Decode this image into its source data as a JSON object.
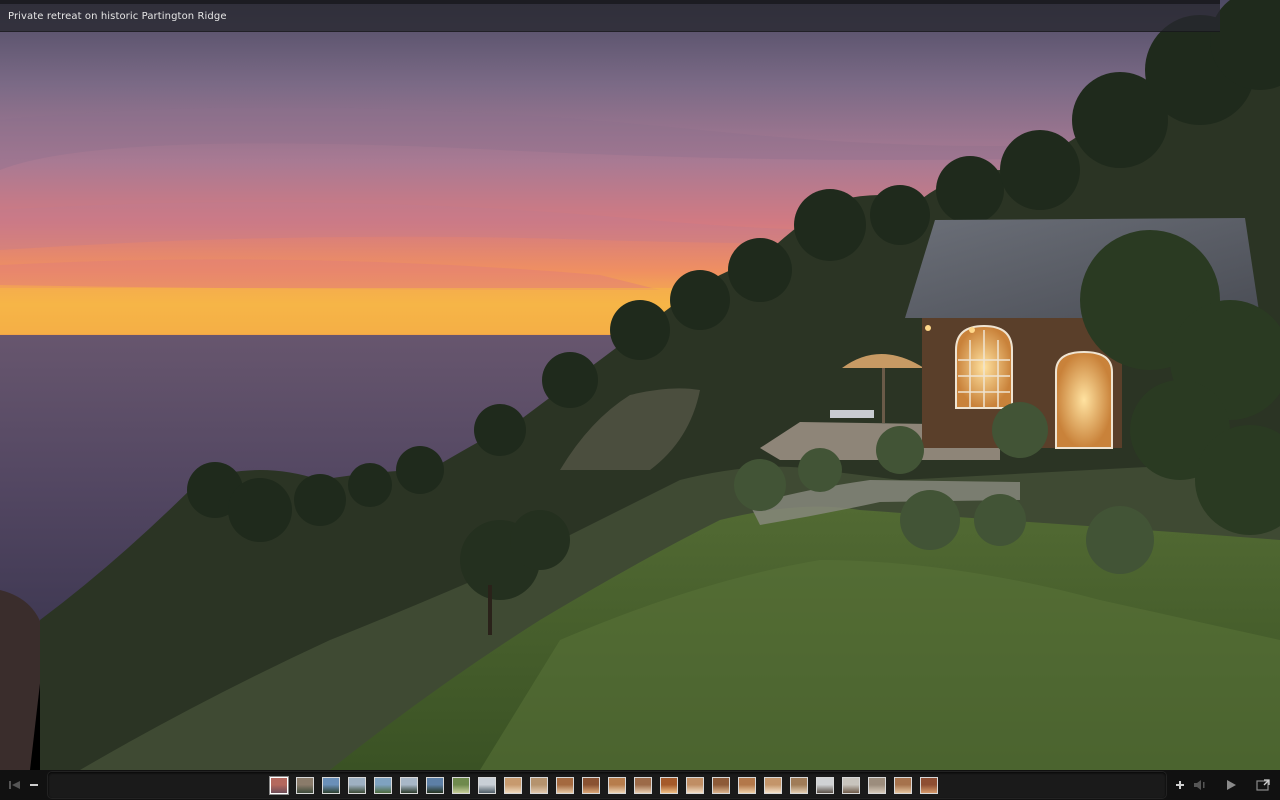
{
  "caption": {
    "title": "Private retreat on historic Partington Ridge"
  },
  "photo": {
    "subject": "house-on-cliff-at-sunset"
  },
  "controls": {
    "first": "skip-to-first-icon",
    "zoom_out": "minus-icon",
    "zoom_in": "plus-icon",
    "volume": "volume-icon",
    "play": "play-icon",
    "fullscreen": "fullscreen-icon"
  },
  "filmstrip": {
    "thumbnails": [
      {
        "index": 1,
        "active": true,
        "colors": [
          "#b4685e",
          "#6e4d58"
        ]
      },
      {
        "index": 2,
        "colors": [
          "#8a7b6a",
          "#3d4a3a"
        ]
      },
      {
        "index": 3,
        "colors": [
          "#6a8fb8",
          "#2c3f2e"
        ]
      },
      {
        "index": 4,
        "colors": [
          "#9eb0c2",
          "#3b4a34"
        ]
      },
      {
        "index": 5,
        "colors": [
          "#7fa2c0",
          "#4d6b3e"
        ]
      },
      {
        "index": 6,
        "colors": [
          "#a8b7c7",
          "#2b3a2a"
        ]
      },
      {
        "index": 7,
        "colors": [
          "#5d7fa6",
          "#24331f"
        ]
      },
      {
        "index": 8,
        "colors": [
          "#6f8a4d",
          "#c8cf9a"
        ]
      },
      {
        "index": 9,
        "colors": [
          "#c9cfd6",
          "#4e5c66"
        ]
      },
      {
        "index": 10,
        "colors": [
          "#c79a6e",
          "#f1dcc0"
        ]
      },
      {
        "index": 11,
        "colors": [
          "#b5936e",
          "#e2cbb0"
        ]
      },
      {
        "index": 12,
        "colors": [
          "#a4693f",
          "#e7c9a5"
        ]
      },
      {
        "index": 13,
        "colors": [
          "#8a5232",
          "#dca878"
        ]
      },
      {
        "index": 14,
        "colors": [
          "#b77d4c",
          "#efd6b6"
        ]
      },
      {
        "index": 15,
        "colors": [
          "#9c6a48",
          "#e9cfb2"
        ]
      },
      {
        "index": 16,
        "colors": [
          "#a55a2a",
          "#f0c087"
        ]
      },
      {
        "index": 17,
        "colors": [
          "#c08e64",
          "#f3dfc6"
        ]
      },
      {
        "index": 18,
        "colors": [
          "#8d5a38",
          "#dcb690"
        ]
      },
      {
        "index": 19,
        "colors": [
          "#b3784a",
          "#efd0a8"
        ]
      },
      {
        "index": 20,
        "colors": [
          "#c4956a",
          "#f6e3cb"
        ]
      },
      {
        "index": 21,
        "colors": [
          "#a07c58",
          "#e4cfb4"
        ]
      },
      {
        "index": 22,
        "colors": [
          "#d0d2d4",
          "#5a5048"
        ]
      },
      {
        "index": 23,
        "colors": [
          "#c8c4bd",
          "#6d5a48"
        ]
      },
      {
        "index": 24,
        "colors": [
          "#9c8d7d",
          "#d7cbbb"
        ]
      },
      {
        "index": 25,
        "colors": [
          "#a6724c",
          "#e6c6a0"
        ]
      },
      {
        "index": 26,
        "colors": [
          "#8e4e32",
          "#d59a6c"
        ]
      }
    ]
  }
}
